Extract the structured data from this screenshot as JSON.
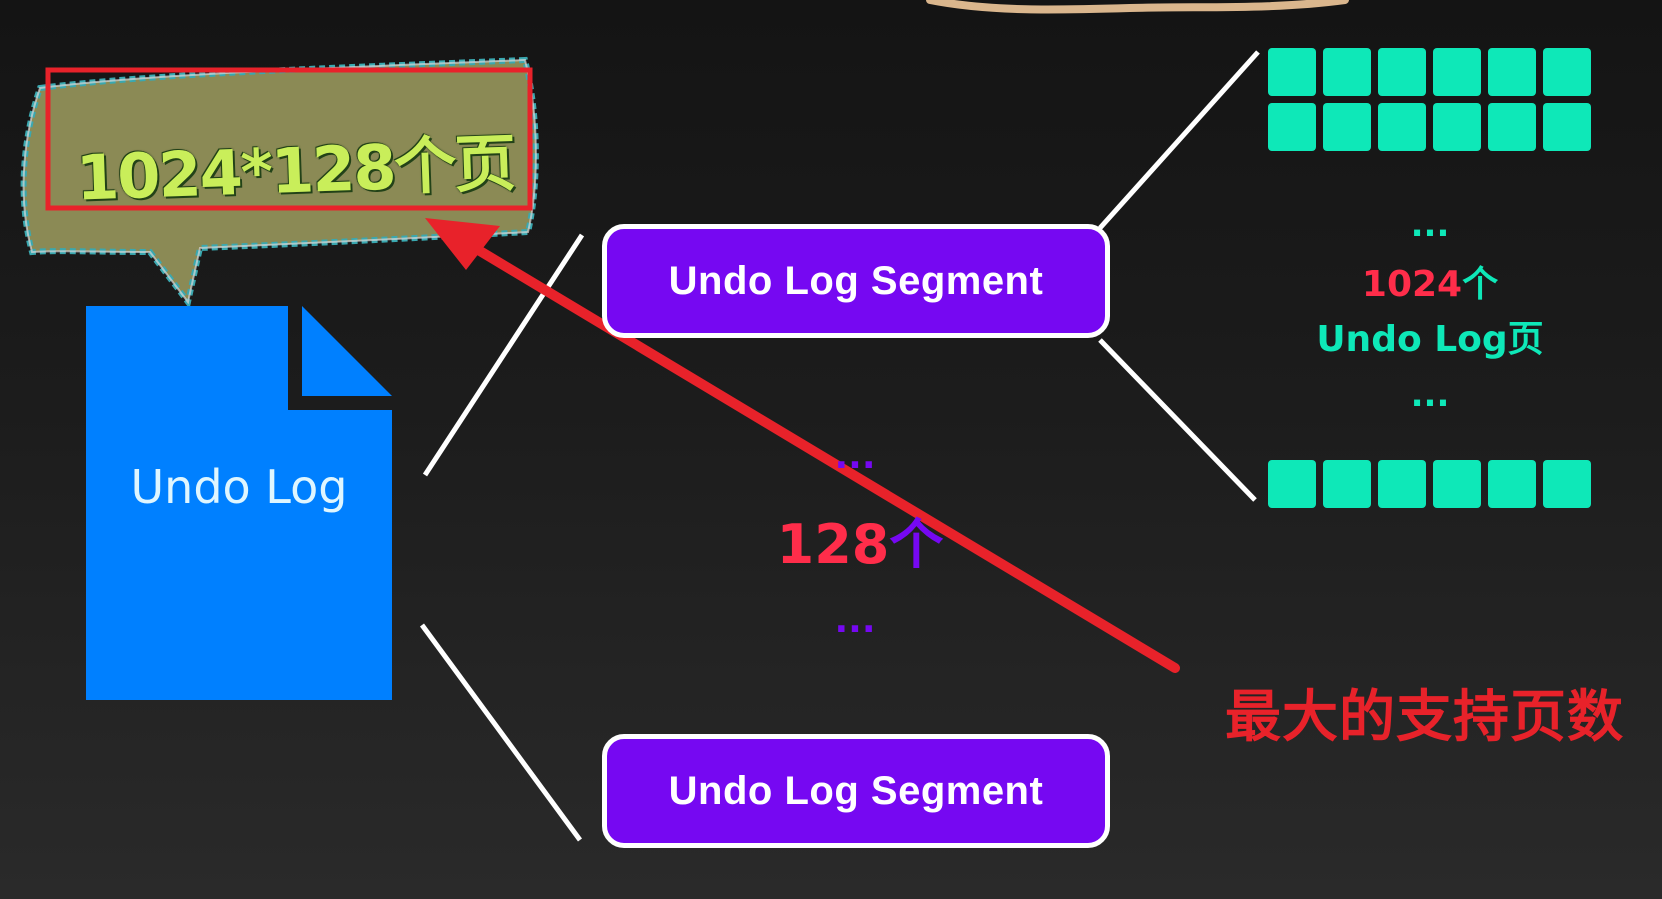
{
  "bubble": {
    "text": "1024*128个页"
  },
  "document": {
    "label": "Undo Log"
  },
  "segments": {
    "top_label": "Undo Log Segment",
    "bottom_label": "Undo Log Segment",
    "ellipsis": "...",
    "count_number": "128",
    "count_unit": "个"
  },
  "pages": {
    "ellipsis": "...",
    "count_number": "1024",
    "count_unit": "个",
    "description": "Undo Log页"
  },
  "annotation": {
    "text": "最大的支持页数"
  },
  "colors": {
    "background": "#1c1c1c",
    "document_blue": "#0080ff",
    "segment_purple": "#7608f2",
    "page_teal": "#0ee8b8",
    "number_red": "#ff2d4a",
    "annotation_red": "#e8222a",
    "bubble_olive": "#8b8a55",
    "bubble_text": "#c9ee5a"
  }
}
